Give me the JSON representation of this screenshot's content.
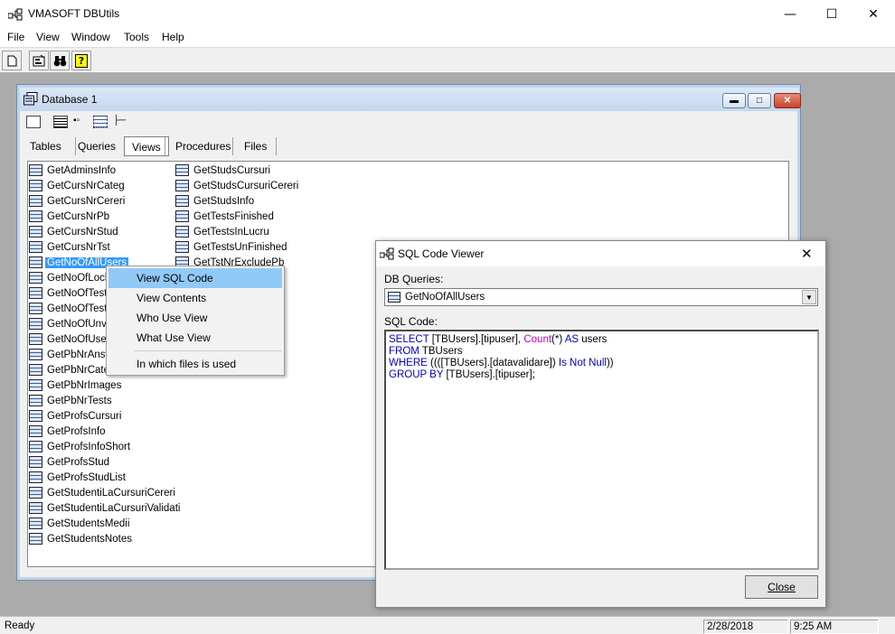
{
  "app": {
    "title": "VMASOFT DBUtils"
  },
  "menu": [
    "File",
    "View",
    "Window",
    "Tools",
    "Help"
  ],
  "db_window": {
    "title": "Database 1",
    "tabs": [
      "Tables",
      "Queries",
      "Views",
      "Procedures",
      "Files"
    ],
    "active_tab": "Views",
    "column1": [
      "GetAdminsInfo",
      "GetCursNrCateg",
      "GetCursNrCereri",
      "GetCursNrPb",
      "GetCursNrStud",
      "GetCursNrTst",
      "GetNoOfAllUsers",
      "GetNoOfLock",
      "GetNoOfTests",
      "GetNoOfTests",
      "GetNoOfUnva",
      "GetNoOfUsers",
      "GetPbNrAnsw",
      "GetPbNrCateg",
      "GetPbNrImages",
      "GetPbNrTests",
      "GetProfsCursuri",
      "GetProfsInfo",
      "GetProfsInfoShort",
      "GetProfsStud",
      "GetProfsStudList",
      "GetStudentiLaCursuriCereri",
      "GetStudentiLaCursuriValidati",
      "GetStudentsMedii",
      "GetStudentsNotes"
    ],
    "column2": [
      "GetStudsCursuri",
      "GetStudsCursuriCereri",
      "GetStudsInfo",
      "GetTestsFinished",
      "GetTestsInLucru",
      "GetTestsUnFinished",
      "GetTstNrExcludePb"
    ],
    "selected_item": "GetNoOfAllUsers"
  },
  "context_menu": {
    "items": [
      "View SQL Code",
      "View Contents",
      "Who Use View",
      "What Use View",
      "In which files is used"
    ],
    "highlighted": "View SQL Code"
  },
  "sql_viewer": {
    "title": "SQL Code Viewer",
    "db_queries_label": "DB Queries:",
    "selected_query": "GetNoOfAllUsers",
    "sql_code_label": "SQL Code:",
    "code_lines": [
      [
        [
          "kw",
          "SELECT"
        ],
        [
          "t",
          " [TBUsers].[tipuser], "
        ],
        [
          "fn",
          "Count"
        ],
        [
          "t",
          "(*) "
        ],
        [
          "kw",
          "AS"
        ],
        [
          "t",
          " users"
        ]
      ],
      [
        [
          "kw",
          "FROM"
        ],
        [
          "t",
          " TBUsers"
        ]
      ],
      [
        [
          "kw",
          "WHERE"
        ],
        [
          "t",
          " ((([TBUsers].[datavalidare]) "
        ],
        [
          "kw",
          "Is Not Null"
        ],
        [
          "t",
          "))"
        ]
      ],
      [
        [
          "kw",
          "GROUP BY"
        ],
        [
          "t",
          " [TBUsers].[tipuser];"
        ]
      ]
    ],
    "close_label": "Close"
  },
  "status": {
    "text": "Ready",
    "date": "2/28/2018",
    "time": "9:25 AM"
  },
  "colors": {
    "selection": "#3399ff",
    "menu_highlight": "#91c9f7",
    "sql_keyword": "#0000cc",
    "sql_function": "#c000c0",
    "mdi_background": "#ababab"
  }
}
